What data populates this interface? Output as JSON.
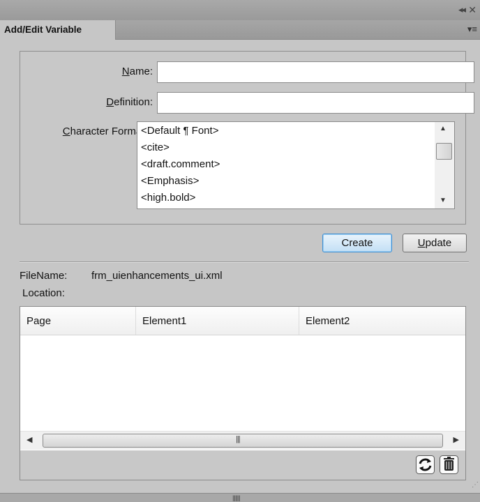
{
  "window": {
    "collapse_icon": "double-chevron-left-icon",
    "close_icon": "close-icon",
    "panel_menu_icon": "panel-menu-icon"
  },
  "tab": {
    "title": "Add/Edit Variable"
  },
  "form": {
    "name_label_key": "N",
    "name_label_rest": "ame:",
    "name_value": "",
    "definition_label_key": "D",
    "definition_label_rest": "efinition:",
    "definition_value": "",
    "charfmt_label_key": "C",
    "charfmt_label_rest": "haracter Formats:",
    "character_formats": [
      "<Default ¶ Font>",
      "<cite>",
      "<draft.comment>",
      "<Emphasis>",
      "<high.bold>"
    ]
  },
  "buttons": {
    "create": "Create",
    "update_key": "U",
    "update_rest": "pdate"
  },
  "info": {
    "filename_label": "FileName:",
    "filename_value": "frm_uienhancements_ui.xml",
    "location_label": "Location:"
  },
  "table": {
    "columns": [
      "Page",
      "Element1",
      "Element2"
    ],
    "rows": []
  },
  "icons": {
    "refresh": "refresh-icon",
    "delete": "trash-icon"
  }
}
